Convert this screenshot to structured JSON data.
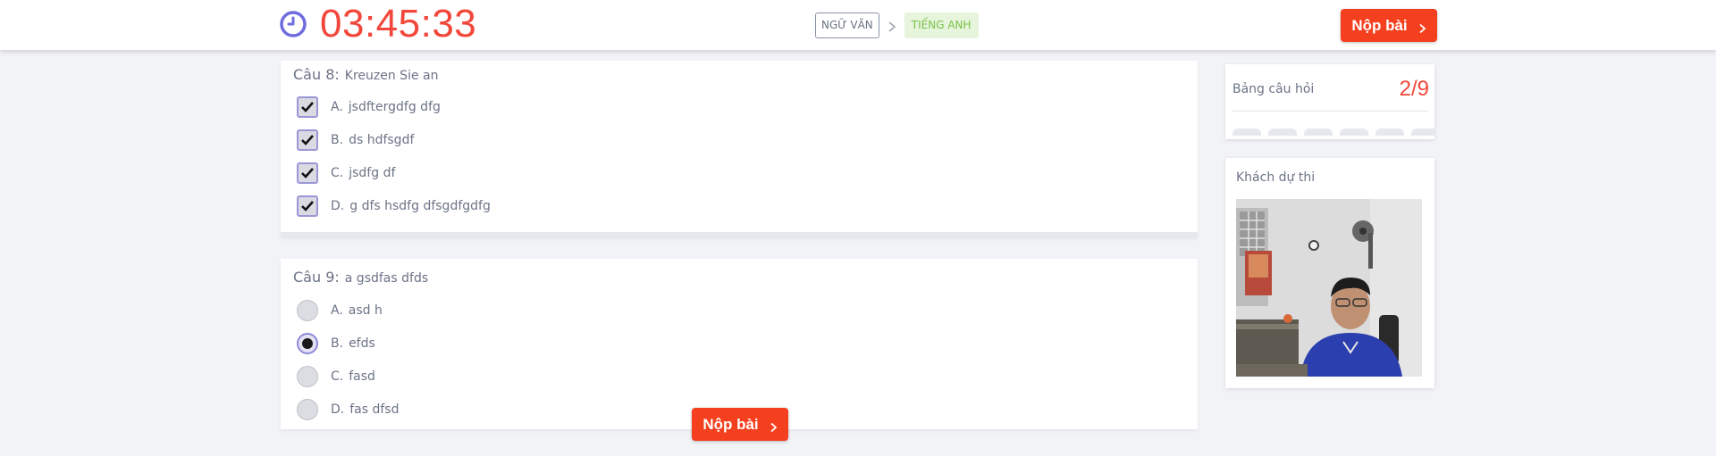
{
  "header": {
    "timer": "03:45:33",
    "subjects": [
      {
        "label": "NGỮ VĂN",
        "active": false
      },
      {
        "label": "TIẾNG ANH",
        "active": true
      }
    ],
    "submit_label": "Nộp bài"
  },
  "questions": [
    {
      "number_label": "Câu 8:",
      "text": "Kreuzen Sie an",
      "type": "checkbox",
      "options": [
        {
          "letter": "A.",
          "text": "jsdftergdfg dfg",
          "checked": true
        },
        {
          "letter": "B.",
          "text": "ds hdfsgdf",
          "checked": true
        },
        {
          "letter": "C.",
          "text": "jsdfg df",
          "checked": true
        },
        {
          "letter": "D.",
          "text": "g dfs hsdfg dfsgdfgdfg",
          "checked": true
        }
      ]
    },
    {
      "number_label": "Câu 9:",
      "text": "a gsdfas dfds",
      "type": "radio",
      "options": [
        {
          "letter": "A.",
          "text": "asd h",
          "checked": false
        },
        {
          "letter": "B.",
          "text": "efds",
          "checked": true
        },
        {
          "letter": "C.",
          "text": "fasd",
          "checked": false
        },
        {
          "letter": "D.",
          "text": "fas dfsd",
          "checked": false
        }
      ]
    }
  ],
  "bottom_submit_label": "Nộp bài",
  "sidebar": {
    "question_board_title": "Bảng câu hỏi",
    "progress": "2/9",
    "candidate_title": "Khách dự thi"
  },
  "colors": {
    "accent": "#f4401f",
    "timer": "#f2473a",
    "clock_icon": "#6f6ce0",
    "active_tab_text": "#7ac24b",
    "active_tab_bg": "#e6f5dc"
  },
  "icons": {
    "clock": "clock-icon",
    "separator": "chevron-right-icon",
    "checkbox_check": "check-icon",
    "button_arrow": "chevron-right-icon"
  }
}
